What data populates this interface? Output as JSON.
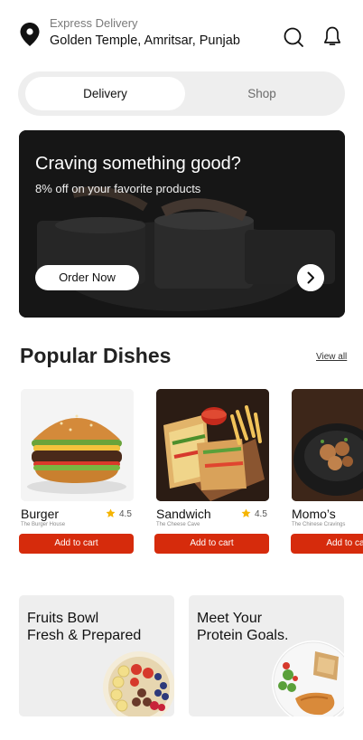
{
  "header": {
    "delivery_label": "Express Delivery",
    "address": "Golden Temple, Amritsar, Punjab",
    "icons": [
      "location-pin-icon",
      "search-icon",
      "bell-icon"
    ]
  },
  "tabs": [
    {
      "label": "Delivery",
      "active": true
    },
    {
      "label": "Shop",
      "active": false
    }
  ],
  "banner": {
    "title": "Craving something good?",
    "subtitle": "8% off on your favorite products",
    "button": "Order Now"
  },
  "popular": {
    "title": "Popular Dishes",
    "view_all": "View all",
    "dishes": [
      {
        "name": "Burger",
        "restaurant": "The Burger House",
        "rating": "4.5",
        "button": "Add to cart"
      },
      {
        "name": "Sandwich",
        "restaurant": "The Cheese Cave",
        "rating": "4.5",
        "button": "Add to cart"
      },
      {
        "name": "Momo’s",
        "restaurant": "The Chinese Cravings",
        "rating": "",
        "button": "Add to cart"
      }
    ]
  },
  "promos": [
    {
      "line1": "Fruits Bowl",
      "line2": "Fresh & Prepared"
    },
    {
      "line1": "Meet Your",
      "line2": "Protein Goals."
    }
  ],
  "colors": {
    "accent": "#d62b0c",
    "star": "#f5b400",
    "tab_bg": "#eeeeee"
  }
}
